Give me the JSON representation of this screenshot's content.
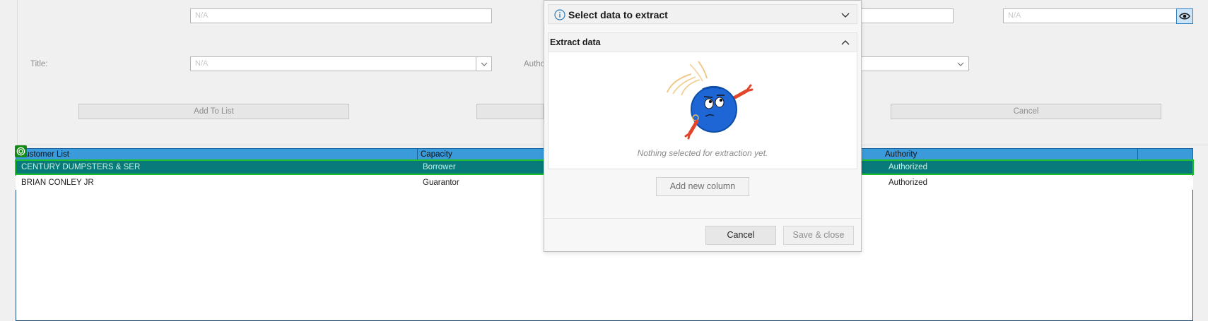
{
  "form": {
    "field_placeholder": "N/A",
    "title_label": "Title:",
    "authority_label_partial": "Autho",
    "add_to_list": "Add To List",
    "cancel": "Cancel"
  },
  "grid": {
    "columns": [
      "Customer List",
      "Capacity",
      "Authority"
    ],
    "rows": [
      {
        "name": "CENTURY DUMPSTERS & SER",
        "capacity": "Borrower",
        "authority": "Authorized",
        "selected": true
      },
      {
        "name": "BRIAN CONLEY  JR",
        "capacity": "Guarantor",
        "authority": "Authorized",
        "selected": false
      }
    ]
  },
  "panel": {
    "select_section_title": "Select data to extract",
    "extract_section_title": "Extract data",
    "empty_message": "Nothing selected for extraction yet.",
    "add_column": "Add new column",
    "cancel": "Cancel",
    "save_close": "Save & close"
  },
  "colors": {
    "header_blue": "#3b9ad9",
    "selected_row": "#087a7a",
    "selection_outline": "#1fbf2c",
    "info_icon": "#2f7fc0",
    "mascot_blue": "#1e66d6",
    "mascot_arms": "#e2452a"
  }
}
